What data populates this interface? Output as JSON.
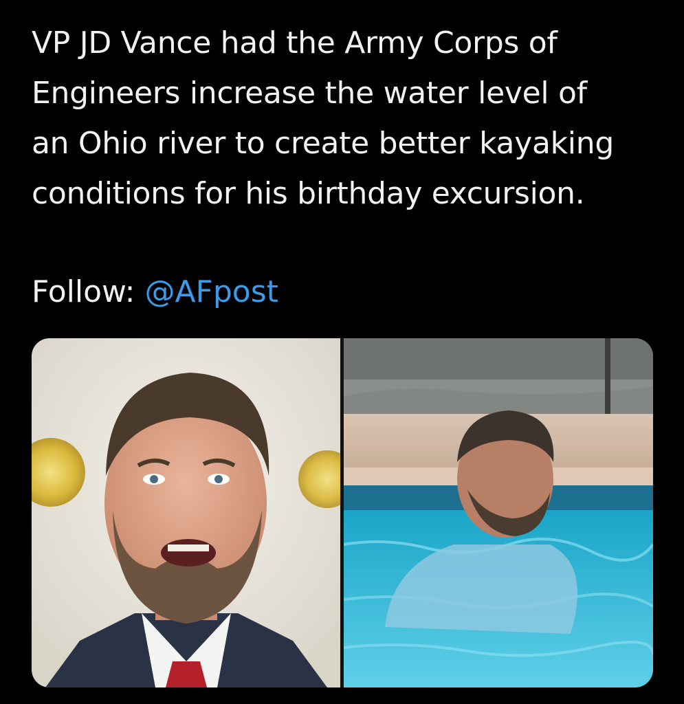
{
  "post": {
    "lines": [
      "VP JD Vance had the Army Corps of",
      "Engineers increase the water level of",
      "an Ohio river to create better kayaking",
      "conditions for his birthday excursion."
    ],
    "follow_label": "Follow:",
    "follow_handle": "@AFpost"
  },
  "media": {
    "left_photo": {
      "icon": "portrait-photo",
      "alt": ""
    },
    "right_photo": {
      "icon": "pool-photo",
      "alt": ""
    }
  },
  "colors": {
    "background": "#000000",
    "text": "#f2f2f2",
    "handle": "#3c9be8"
  }
}
